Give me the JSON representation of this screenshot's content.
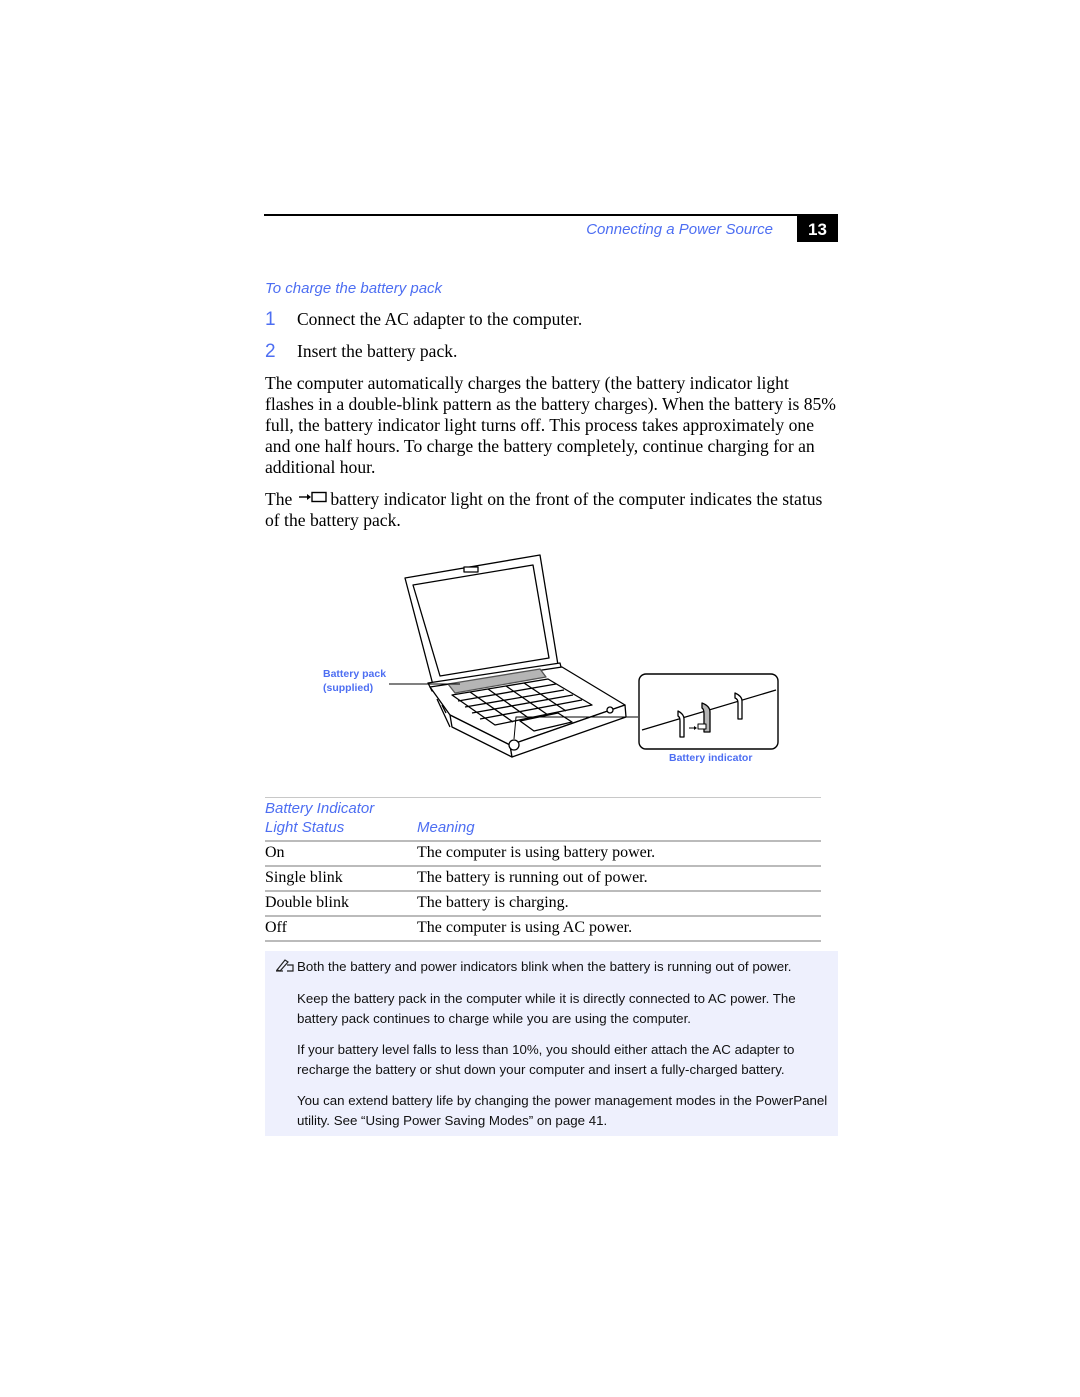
{
  "header": {
    "running_head": "Connecting a Power Source",
    "page_number": "13"
  },
  "procedure": {
    "title": "To charge the battery pack",
    "steps": [
      {
        "num": "1",
        "text": "Connect the AC adapter to the computer."
      },
      {
        "num": "2",
        "text": "Insert the battery pack."
      }
    ]
  },
  "body": {
    "paragraph1": "The computer automatically charges the battery (the battery indicator light flashes in a double-blink pattern as the battery charges). When the battery is 85% full, the battery indicator light turns off. This process takes approximately one and one half hours. To charge the battery completely, continue charging for an additional hour.",
    "paragraph2_before": "The",
    "paragraph2_icon": "battery-indicator-icon",
    "paragraph2_after": "battery indicator light on the front of the computer indicates the status of the battery pack."
  },
  "figure": {
    "callout_battery_pack_line1": "Battery pack",
    "callout_battery_pack_line2": "(supplied)",
    "callout_battery_indicator": "Battery indicator"
  },
  "table": {
    "headers": {
      "col1_line1": "Battery Indicator",
      "col1_line2": "Light Status",
      "col2": "Meaning"
    },
    "rows": [
      {
        "status": "On",
        "meaning": "The computer is using battery power."
      },
      {
        "status": "Single blink",
        "meaning": "The battery is running out of power."
      },
      {
        "status": "Double blink",
        "meaning": "The battery is charging."
      },
      {
        "status": "Off",
        "meaning": "The computer is using AC power."
      }
    ]
  },
  "note": {
    "icon": "note-pencil-icon",
    "paragraphs": [
      "Both the battery and power indicators blink when the battery is running out of power.",
      "Keep the battery pack in the computer while it is directly connected to AC power. The battery pack continues to charge while you are using the computer.",
      "If your battery level falls to less than 10%, you should either attach the AC adapter to recharge the battery or shut down your computer and insert a fully-charged battery.",
      "You can extend battery life by changing the power management modes in the PowerPanel utility. See “Using Power Saving Modes” on page 41."
    ]
  },
  "colors": {
    "accent_blue": "#4d6ef2",
    "note_background": "#eef0fd"
  }
}
